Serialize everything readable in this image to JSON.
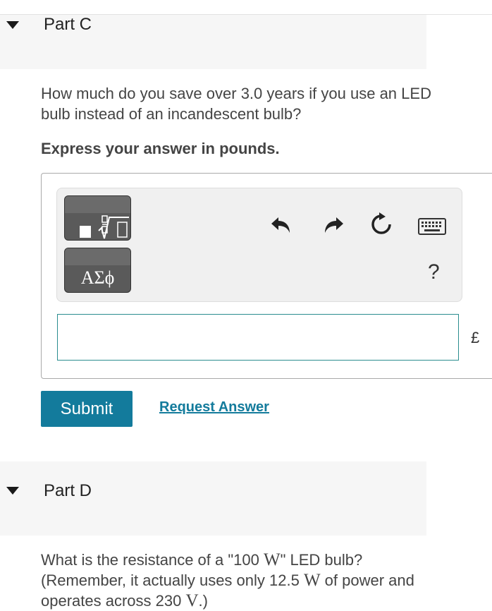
{
  "part_c": {
    "title": "Part C",
    "question": "How much do you save over 3.0 years if you use an LED bulb instead of an incandescent bulb?",
    "instruction": "Express your answer in pounds.",
    "toolbar": {
      "templates_icon": "templates-sqrt-icon",
      "symbols_label": "ΑΣϕ",
      "undo_icon": "undo-icon",
      "redo_icon": "redo-icon",
      "reset_icon": "reset-icon",
      "keyboard_icon": "keyboard-icon",
      "help_label": "?"
    },
    "answer_value": "",
    "unit": "£",
    "submit_label": "Submit",
    "request_label": "Request Answer"
  },
  "part_d": {
    "title": "Part D",
    "question_pre": "What is the resistance of a \"100 ",
    "unit_w1": "W",
    "question_mid1": "\" LED bulb? (Remember, it actually uses only 12.5 ",
    "unit_w2": "W",
    "question_mid2": " of power and operates across 230 ",
    "unit_v": "V",
    "question_end": ".)"
  },
  "colors": {
    "accent": "#137b9c",
    "input_border": "#2a8d8f",
    "header_bg": "#f6f6f6",
    "toolbar_bg": "#f0f0f0"
  }
}
